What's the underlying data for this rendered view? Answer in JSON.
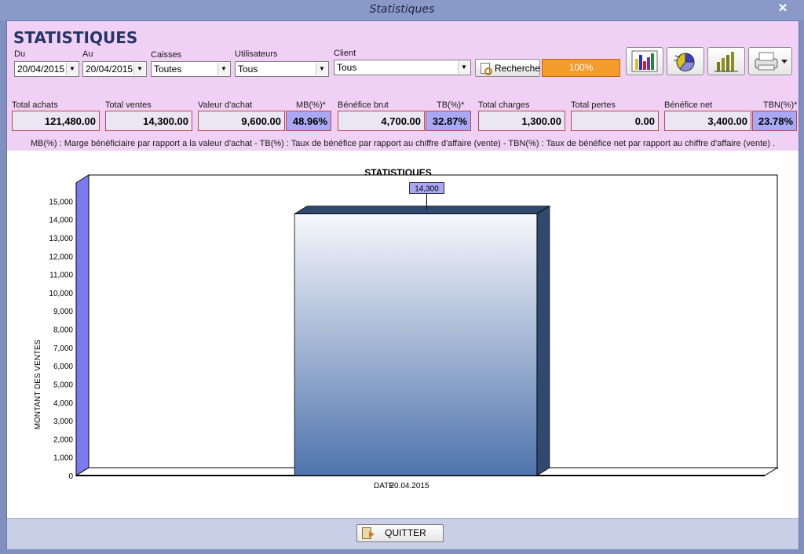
{
  "window": {
    "title": "Statistiques",
    "close_glyph": "✕"
  },
  "app": {
    "title": "STATISTIQUES"
  },
  "filters": {
    "du": {
      "label": "Du",
      "value": "20/04/2015"
    },
    "au": {
      "label": "Au",
      "value": "20/04/2015"
    },
    "caisses": {
      "label": "Caisses",
      "value": "Toutes"
    },
    "utilisateurs": {
      "label": "Utilisateurs",
      "value": "Tous"
    },
    "client": {
      "label": "Client",
      "value": "Tous"
    },
    "search_label": "Recherche",
    "progress_text": "100%",
    "progress_value": 1.0
  },
  "toolbar": {
    "icons": [
      "bar-chart-3d-icon",
      "pie-chart-icon",
      "column-chart-icon",
      "print-icon"
    ]
  },
  "stats": {
    "total_achats": {
      "label": "Total achats",
      "value": "121,480.00"
    },
    "total_ventes": {
      "label": "Total ventes",
      "value": "14,300.00"
    },
    "valeur_achat": {
      "label": "Valeur d'achat",
      "value": "9,600.00"
    },
    "mb": {
      "label": "MB(%)*",
      "value": "48.96%"
    },
    "benefice_brut": {
      "label": "Bénéfice brut",
      "value": "4,700.00"
    },
    "tb": {
      "label": "TB(%)*",
      "value": "32.87%"
    },
    "total_charges": {
      "label": "Total charges",
      "value": "1,300.00"
    },
    "total_pertes": {
      "label": "Total pertes",
      "value": "0.00"
    },
    "benefice_net": {
      "label": "Bénéfice net",
      "value": "3,400.00"
    },
    "tbn": {
      "label": "TBN(%)*",
      "value": "23.78%"
    }
  },
  "legend": "MB(%) : Marge bénéficiaire par rapport a la valeur d'achat  -  TB(%) : Taux de bénéfice par rapport au chiffre d'affaire (vente)  -  TBN(%) : Taux de bénéfice net par rapport au chiffre d'affaire (vente) .",
  "chart_data": {
    "type": "bar",
    "title": "STATISTIQUES",
    "xlabel": "DATE",
    "ylabel": "MONTANT DES VENTES",
    "categories": [
      "20.04.2015"
    ],
    "values": [
      14300
    ],
    "data_labels": [
      "14,300"
    ],
    "ylim": [
      0,
      16000
    ],
    "yticks": [
      0,
      1000,
      2000,
      3000,
      4000,
      5000,
      6000,
      7000,
      8000,
      9000,
      10000,
      11000,
      12000,
      13000,
      14000,
      15000
    ],
    "ytick_labels": [
      "0",
      "1,000",
      "2,000",
      "3,000",
      "4,000",
      "5,000",
      "6,000",
      "7,000",
      "8,000",
      "9,000",
      "10,000",
      "11,000",
      "12,000",
      "13,000",
      "14,000",
      "15,000"
    ],
    "grid": true,
    "colors": {
      "bar_top": "#f7f8fc",
      "bar_bottom": "#4f74ad",
      "bar_side": "#2f4a6e",
      "label_bg": "#a9a9f5",
      "wall": "#7b7bef"
    }
  },
  "footer": {
    "quit_label": "QUITTER"
  }
}
